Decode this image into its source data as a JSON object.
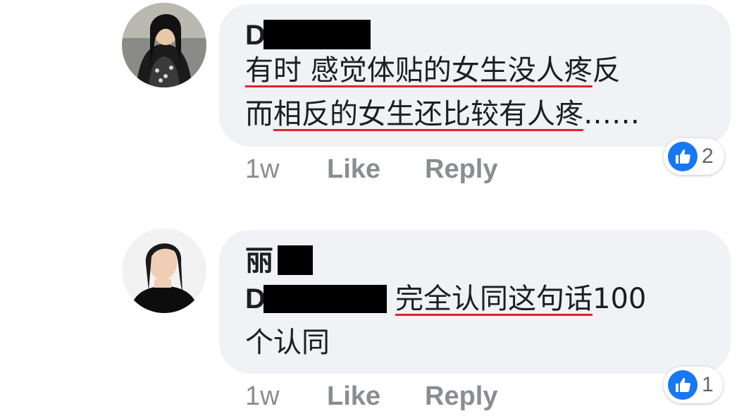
{
  "comments": [
    {
      "author_visible": "D",
      "lines": [
        {
          "underlined": "有时 感觉体贴的女生没人疼",
          "plain": "反"
        },
        {
          "plain_before": "而",
          "underlined": "相反的女生还比较有人疼",
          "plain": "……"
        }
      ],
      "time": "1w",
      "like_label": "Like",
      "reply_label": "Reply",
      "reaction_count": "2"
    },
    {
      "author_visible": "丽",
      "mention_visible": "D",
      "lines": [
        {
          "underlined": "完全认同这句话",
          "plain": "100"
        },
        {
          "plain": "个认同"
        }
      ],
      "time": "1w",
      "like_label": "Like",
      "reply_label": "Reply",
      "reaction_count": "1"
    }
  ],
  "colors": {
    "bubble": "#f0f2f5",
    "underline": "#e0252b",
    "like": "#1877f2",
    "meta": "#8a8d91"
  },
  "icons": [
    "thumbs-up-icon"
  ]
}
